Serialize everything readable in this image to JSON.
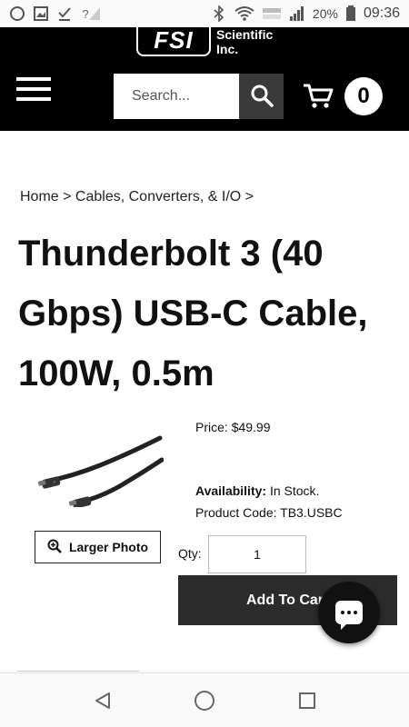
{
  "status_bar": {
    "battery_pct": "20%",
    "time": "09:36",
    "signal_hint": "?"
  },
  "header": {
    "logo_mark": "FSI",
    "logo_text_line1": "Scientific",
    "logo_text_line2": "Inc.",
    "search_placeholder": "Search...",
    "cart_count": "0"
  },
  "breadcrumb": {
    "home": "Home",
    "sep": " > ",
    "category": "Cables, Converters, & I/O",
    "trail_end": " >"
  },
  "product": {
    "title": "Thunderbolt 3 (40 Gbps) USB-C Cable, 100W, 0.5m",
    "price_label": "Price:",
    "price": "$49.99",
    "availability_label": "Availability:",
    "availability": "In Stock.",
    "code_label": "Product Code:",
    "code": "TB3.USBC",
    "larger_photo_label": "Larger Photo",
    "qty_label": "Qty:",
    "qty_value": "1",
    "add_to_cart_label": "Add To Cart"
  },
  "icons": {
    "menu": "hamburger-icon",
    "search": "search-icon",
    "cart": "cart-icon",
    "zoom": "zoom-in-icon",
    "chat": "chat-icon",
    "nav_back": "back-icon",
    "nav_home": "home-icon",
    "nav_recents": "recents-icon"
  },
  "colors": {
    "header_bg": "#000000",
    "button_dark": "#2b2b2b",
    "search_button": "#3a3a3a"
  }
}
